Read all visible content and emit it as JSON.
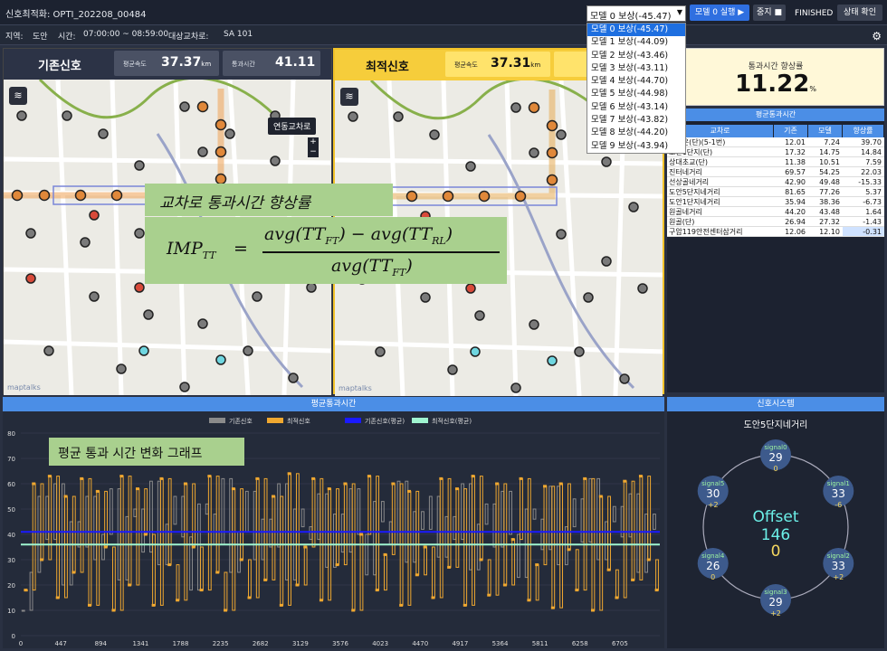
{
  "header": {
    "title": "신호최적화: OPTI_202208_00484",
    "model_select": "모델 0 보상(-45.47)",
    "run_label": "모델 0 실행 ▶",
    "stop_label": "중지 ■",
    "status_text": "FINISHED",
    "status_button": "상태 확인"
  },
  "dropdown": {
    "options": [
      "모델 0 보상(-45.47)",
      "모델 1 보상(-44.09)",
      "모델 2 보상(-43.46)",
      "모델 3 보상(-43.11)",
      "모델 4 보상(-44.70)",
      "모델 5 보상(-44.98)",
      "모델 6 보상(-43.14)",
      "모델 7 보상(-43.82)",
      "모델 8 보상(-44.20)",
      "모델 9 보상(-43.94)"
    ]
  },
  "info": {
    "region_label": "지역:",
    "region": "도안",
    "time_label": "시간:",
    "time": "07:00:00 ~ 08:59:00",
    "target_label": "대상교차로:",
    "target": "SA 101"
  },
  "left_panel": {
    "title": "기존신호",
    "speed_label": "평균속도",
    "speed_value": "37.37",
    "speed_unit": "km",
    "time_label": "통과시간",
    "time_value": "41.11",
    "cross_label": "연동교차로",
    "maptalks": "maptalks"
  },
  "right_panel": {
    "title": "최적신호",
    "speed_label": "평균속도",
    "speed_value": "37.31",
    "speed_unit": "km",
    "maptalks": "maptalks"
  },
  "kpi": {
    "label": "통과시간 향상률",
    "value": "11.22",
    "unit": "%"
  },
  "table": {
    "title": "평균통과시간",
    "columns": [
      "교차로",
      "기존",
      "모델",
      "향상률"
    ],
    "rows": [
      [
        "고우운(단)(5-1번)",
        "12.01",
        "7.24",
        "39.70"
      ],
      [
        "도안1단지(단)",
        "17.32",
        "14.75",
        "14.84"
      ],
      [
        "상대초교(단)",
        "11.38",
        "10.51",
        "7.59"
      ],
      [
        "진터네거리",
        "69.57",
        "54.25",
        "22.03"
      ],
      [
        "선상골네거리",
        "42.90",
        "49.48",
        "-15.33"
      ],
      [
        "도안5단지네거리",
        "81.65",
        "77.26",
        "5.37"
      ],
      [
        "도안1단지네거리",
        "35.94",
        "38.36",
        "-6.73"
      ],
      [
        "원골네거리",
        "44.20",
        "43.48",
        "1.64"
      ],
      [
        "원골(단)",
        "26.94",
        "27.32",
        "-1.43"
      ],
      [
        "구암119안전센터삼거리",
        "12.06",
        "12.10",
        "-0.31"
      ]
    ]
  },
  "overlay": {
    "title": "교차로 통과시간 향상률",
    "lhs": "IMP",
    "lhs_sub": "TT",
    "num_a": "avg(TT",
    "num_a_sub": "FT",
    "num_b": ") − avg(TT",
    "num_b_sub": "RL",
    "num_c": ")",
    "den_a": "avg(TT",
    "den_sub": "FT",
    "den_c": ")",
    "chart_note": "평균 통과 시간 변화 그래프"
  },
  "chart": {
    "title": "평균통과시간",
    "legend": [
      "기존신호",
      "최적신호",
      "기존신호(평균)",
      "최적신호(평균)"
    ],
    "colors": [
      "#8a8a8a",
      "#f0a830",
      "#1a1aff",
      "#9ff5d0"
    ]
  },
  "chart_data": {
    "type": "bar",
    "title": "평균통과시간",
    "series": [
      {
        "name": "기존신호",
        "values": [
          10,
          25,
          55,
          38,
          60,
          20,
          45,
          35,
          55,
          30,
          40,
          58,
          22,
          47,
          50,
          33,
          61,
          28,
          44,
          55,
          39,
          18,
          52,
          48,
          36,
          62,
          25,
          41,
          57,
          30,
          46,
          35,
          60,
          22,
          50,
          43,
          38,
          56,
          27,
          48,
          33,
          58,
          40,
          24,
          53,
          45,
          36,
          61,
          29,
          49,
          42,
          55,
          31,
          47,
          38,
          60,
          26,
          44,
          52,
          35,
          57,
          40,
          23,
          50,
          46,
          34,
          59,
          28,
          43,
          54,
          37,
          62,
          30,
          45,
          51,
          39,
          56,
          25,
          48,
          42
        ]
      },
      {
        "name": "최적신호",
        "values": [
          18,
          60,
          30,
          63,
          15,
          55,
          25,
          62,
          12,
          57,
          35,
          10,
          63,
          20,
          58,
          40,
          12,
          62,
          28,
          14,
          60,
          35,
          18,
          63,
          25,
          10,
          58,
          30,
          15,
          62,
          22,
          55,
          12,
          64,
          20,
          35,
          62,
          14,
          58,
          28,
          60,
          10,
          40,
          63,
          18,
          32,
          60,
          12,
          57,
          24,
          35,
          15,
          62,
          27,
          58,
          12,
          63,
          30,
          16,
          60,
          20,
          38,
          62,
          14,
          28,
          59,
          11,
          60,
          34,
          18,
          62,
          10,
          55,
          26,
          15,
          61,
          22,
          63,
          30,
          18
        ]
      },
      {
        "name": "기존신호(평균)",
        "values": [
          41
        ]
      },
      {
        "name": "최적신호(평균)",
        "values": [
          36
        ]
      }
    ],
    "x_ticks": [
      "0",
      "447",
      "894",
      "1341",
      "1788",
      "2235",
      "2682",
      "3129",
      "3576",
      "4023",
      "4470",
      "4917",
      "5364",
      "5811",
      "6258",
      "6705"
    ],
    "y_ticks": [
      0,
      10,
      20,
      30,
      40,
      50,
      60,
      70,
      80
    ],
    "ylim": [
      0,
      80
    ]
  },
  "signal": {
    "title": "신호시스템",
    "name": "도안5단지네거리",
    "offset_label": "Offset",
    "offset_value": "146",
    "offset_sub": "0",
    "nodes": [
      {
        "label": "signal0",
        "value": "29",
        "delta": "0"
      },
      {
        "label": "signal1",
        "value": "33",
        "delta": "-6"
      },
      {
        "label": "signal2",
        "value": "33",
        "delta": "+2"
      },
      {
        "label": "signal3",
        "value": "29",
        "delta": "+2"
      },
      {
        "label": "signal4",
        "value": "26",
        "delta": "0"
      },
      {
        "label": "signal5",
        "value": "30",
        "delta": "+2"
      }
    ]
  }
}
